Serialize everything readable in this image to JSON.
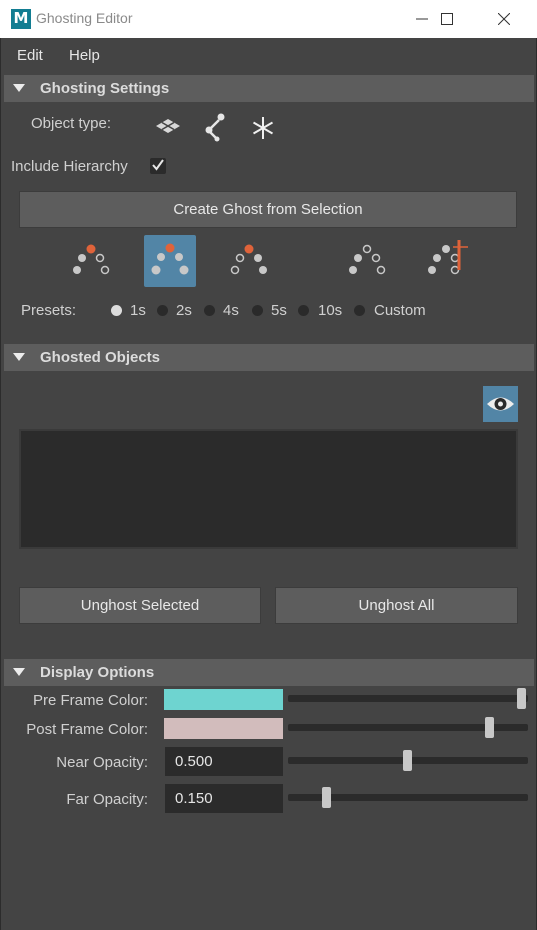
{
  "window": {
    "title": "Ghosting Editor",
    "app_icon_letter": "M"
  },
  "menu": [
    "Edit",
    "Help"
  ],
  "ghosting_settings": {
    "header": "Ghosting Settings",
    "object_type_label": "Object type:",
    "object_type_icons": [
      "geometry-icon",
      "joint-icon",
      "locator-icon"
    ],
    "include_hierarchy_label": "Include Hierarchy",
    "include_hierarchy_checked": true,
    "create_button": "Create Ghost from Selection",
    "ghost_mode_icons": [
      "ghost-mode-previous-icon",
      "ghost-mode-both-icon",
      "ghost-mode-next-icon",
      "ghost-mode-custom-icon",
      "ghost-mode-keyframes-icon"
    ],
    "presets_label": "Presets:",
    "presets": [
      "1s",
      "2s",
      "4s",
      "5s",
      "10s",
      "Custom"
    ],
    "selected_preset": "1s",
    "accent_color": "#e0633a",
    "selected_color": "#5285a6"
  },
  "ghosted_objects": {
    "header": "Ghosted Objects",
    "visibility_icon": "eye-icon",
    "unghost_selected": "Unghost Selected",
    "unghost_all": "Unghost All"
  },
  "display_options": {
    "header": "Display Options",
    "pre_frame_label": "Pre Frame Color:",
    "pre_frame_color": "#6ed4d0",
    "pre_frame_slider": 1.0,
    "post_frame_label": "Post Frame Color:",
    "post_frame_color": "#d2bcbc",
    "post_frame_slider": 0.86,
    "near_opacity_label": "Near Opacity:",
    "near_opacity_value": "0.500",
    "near_opacity": 0.5,
    "far_opacity_label": "Far Opacity:",
    "far_opacity_value": "0.150",
    "far_opacity": 0.15
  }
}
